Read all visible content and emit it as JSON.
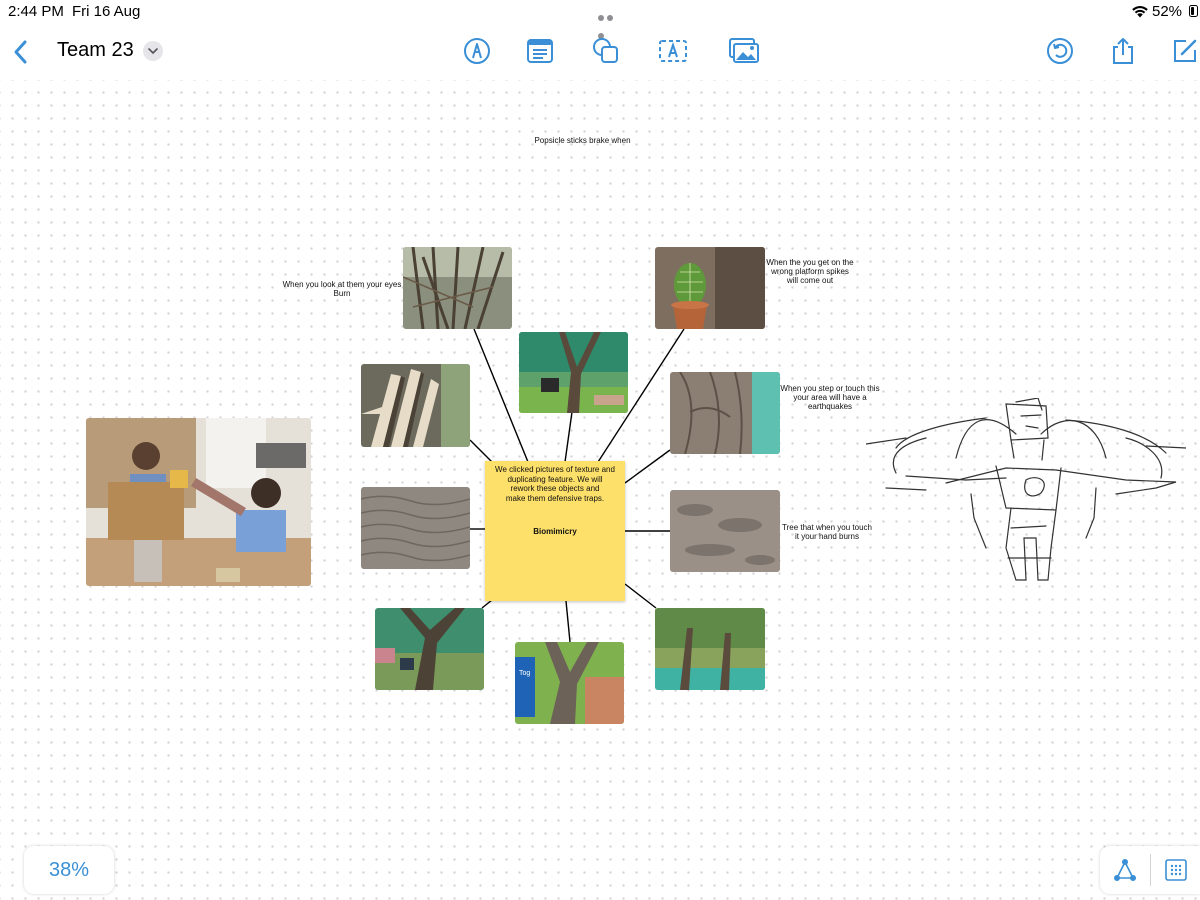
{
  "status_bar": {
    "time": "2:44 PM",
    "date": "Fri 16 Aug",
    "battery": "52%"
  },
  "toolbar": {
    "title": "Team 23",
    "tools": [
      "back-icon",
      "pen-icon",
      "text-box-icon",
      "shapes-icon",
      "text-icon",
      "media-icon",
      "undo-icon",
      "share-icon",
      "compose-icon"
    ]
  },
  "board": {
    "top_note": "Popsicle sticks brake when",
    "labels": {
      "eyes_burn": [
        "When you look at them your eyes",
        "Burn"
      ],
      "platform_spikes": [
        "When the  you get on the",
        "wrong platform spikes",
        "will come out"
      ],
      "earthquakes": [
        "When you step or touch this",
        "your area will have a",
        "earthquakes"
      ],
      "hand_burns": [
        "Tree that when you touch",
        "it your hand burns"
      ]
    },
    "sticky": {
      "body": [
        "We clicked pictures of texture and",
        "duplicating feature. We will",
        "rework these objects and",
        "make them defensive traps."
      ],
      "title": "Biomimicry"
    },
    "photo_sign_text": "Tog"
  },
  "bottom": {
    "zoom": "38%"
  },
  "colors": {
    "accent": "#3a8fd6",
    "sticky": "#fde069",
    "canvas_dot": "#d2d2d6"
  }
}
